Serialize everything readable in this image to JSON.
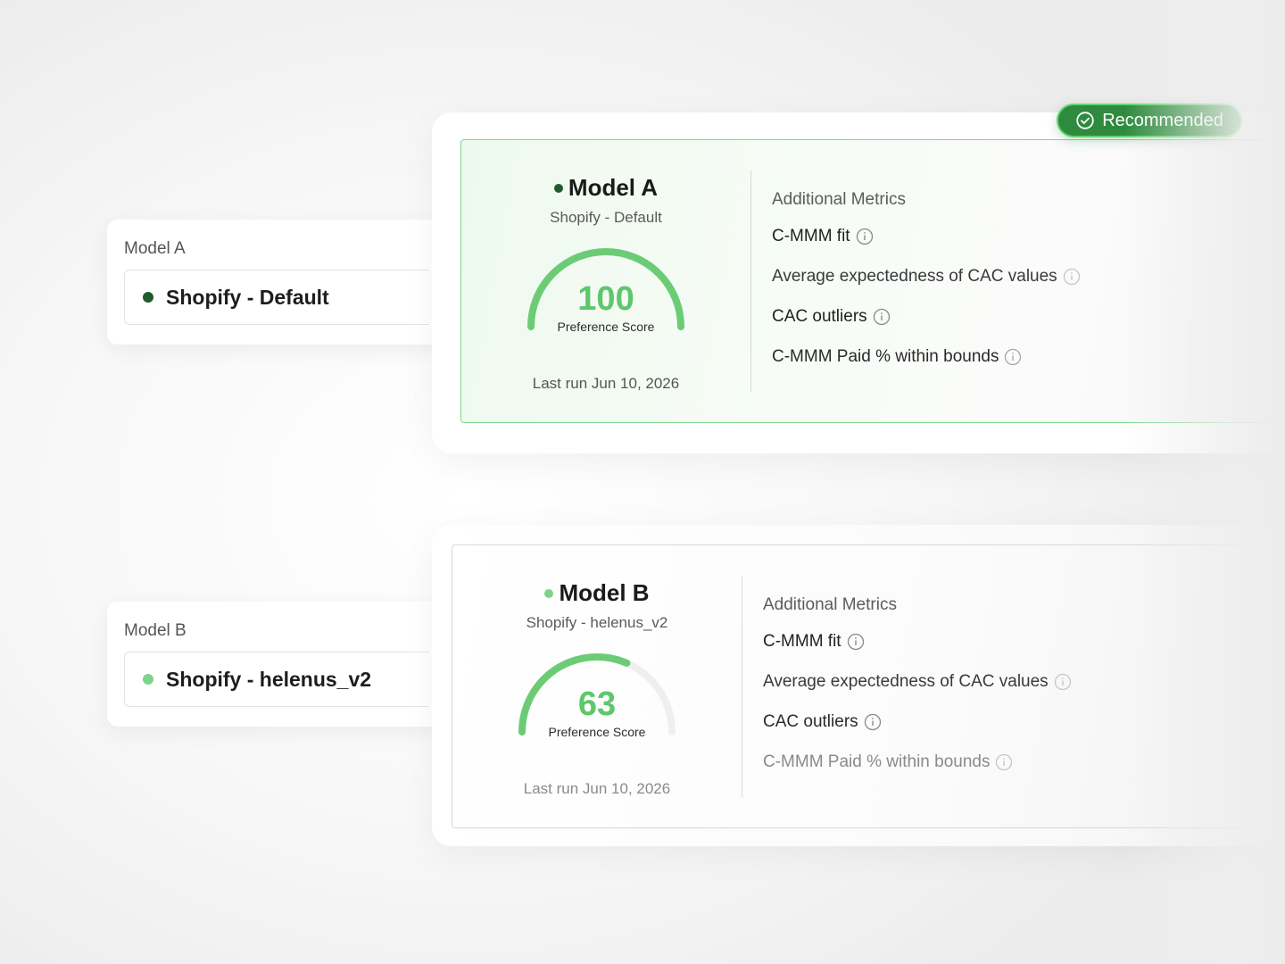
{
  "colors": {
    "accent": "#5fc66c",
    "recommended_bg": "#2e8b3d",
    "dot_model_a": "#1f5c2b",
    "dot_model_b": "#7fd28b"
  },
  "selectors": [
    {
      "label": "Model A",
      "value": "Shopify - Default"
    },
    {
      "label": "Model B",
      "value": "Shopify - helenus_v2"
    }
  ],
  "badge": {
    "label": "Recommended",
    "icon": "check-circle-icon"
  },
  "models": [
    {
      "title": "Model A",
      "subtitle": "Shopify - Default",
      "score": "100",
      "score_fraction": 1.0,
      "score_caption": "Preference Score",
      "last_run": "Last run Jun 10, 2026",
      "metrics_heading": "Additional Metrics",
      "metrics": [
        {
          "label": "C-MMM fit",
          "icon": "info-icon"
        },
        {
          "label": "Average expectedness of CAC values",
          "icon": "info-icon"
        },
        {
          "label": "CAC outliers",
          "icon": "info-icon"
        },
        {
          "label": "C-MMM Paid % within bounds",
          "icon": "info-icon"
        }
      ]
    },
    {
      "title": "Model B",
      "subtitle": "Shopify - helenus_v2",
      "score": "63",
      "score_fraction": 0.63,
      "score_caption": "Preference Score",
      "last_run": "Last run Jun 10, 2026",
      "metrics_heading": "Additional Metrics",
      "metrics": [
        {
          "label": "C-MMM fit",
          "icon": "info-icon"
        },
        {
          "label": "Average expectedness of CAC values",
          "icon": "info-icon"
        },
        {
          "label": "CAC outliers",
          "icon": "info-icon"
        },
        {
          "label": "C-MMM Paid % within bounds",
          "icon": "info-icon"
        }
      ]
    }
  ]
}
